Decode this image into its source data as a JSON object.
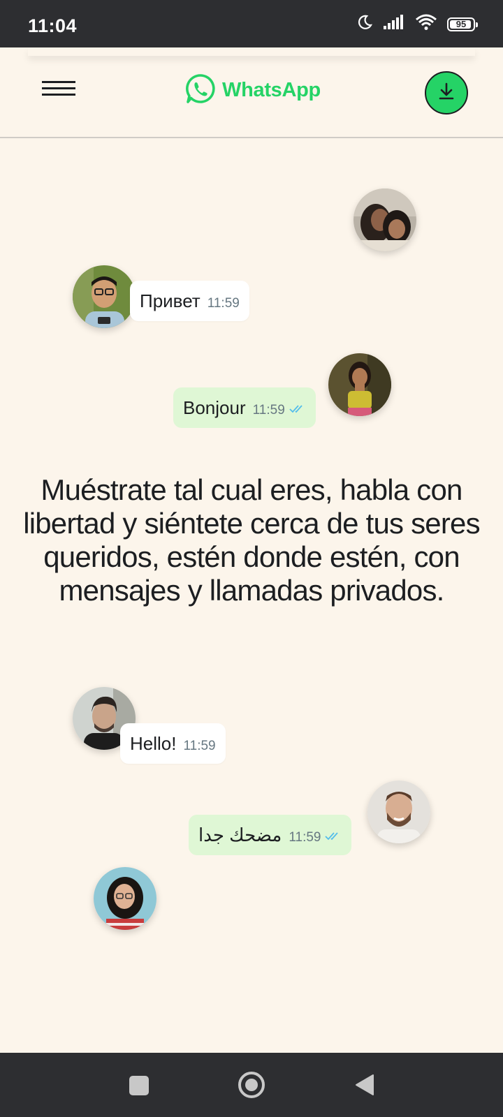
{
  "status_bar": {
    "time": "11:04",
    "battery": "95",
    "battery_level": 0.95,
    "icons": [
      "moon-icon",
      "signal-icon",
      "wifi-icon",
      "battery-icon"
    ]
  },
  "header": {
    "logo_text": "WhatsApp",
    "menu_icon": "hamburger-menu-icon",
    "download_icon": "download-icon",
    "brand_color": "#25d366"
  },
  "messages": [
    {
      "text": "Привет",
      "time": "11:59",
      "direction": "incoming"
    },
    {
      "text": "Bonjour",
      "time": "11:59",
      "direction": "outgoing",
      "read": true
    },
    {
      "text": "Hello!",
      "time": "11:59",
      "direction": "incoming"
    },
    {
      "text": "مضحك جدا",
      "time": "11:59",
      "direction": "outgoing",
      "read": true
    }
  ],
  "headline": "Muéstrate tal cual eres, habla con libertad y siéntete cerca de tus seres queridos, estén donde estén, con mensajes y llamadas privados.",
  "nav_bar": {
    "buttons": [
      "recents-square-icon",
      "home-circle-icon",
      "back-triangle-icon"
    ]
  },
  "colors": {
    "page_background": "#fcf5eb",
    "outgoing_bubble": "#dff7d5",
    "incoming_bubble": "#ffffff",
    "read_ticks": "#53bdeb"
  }
}
